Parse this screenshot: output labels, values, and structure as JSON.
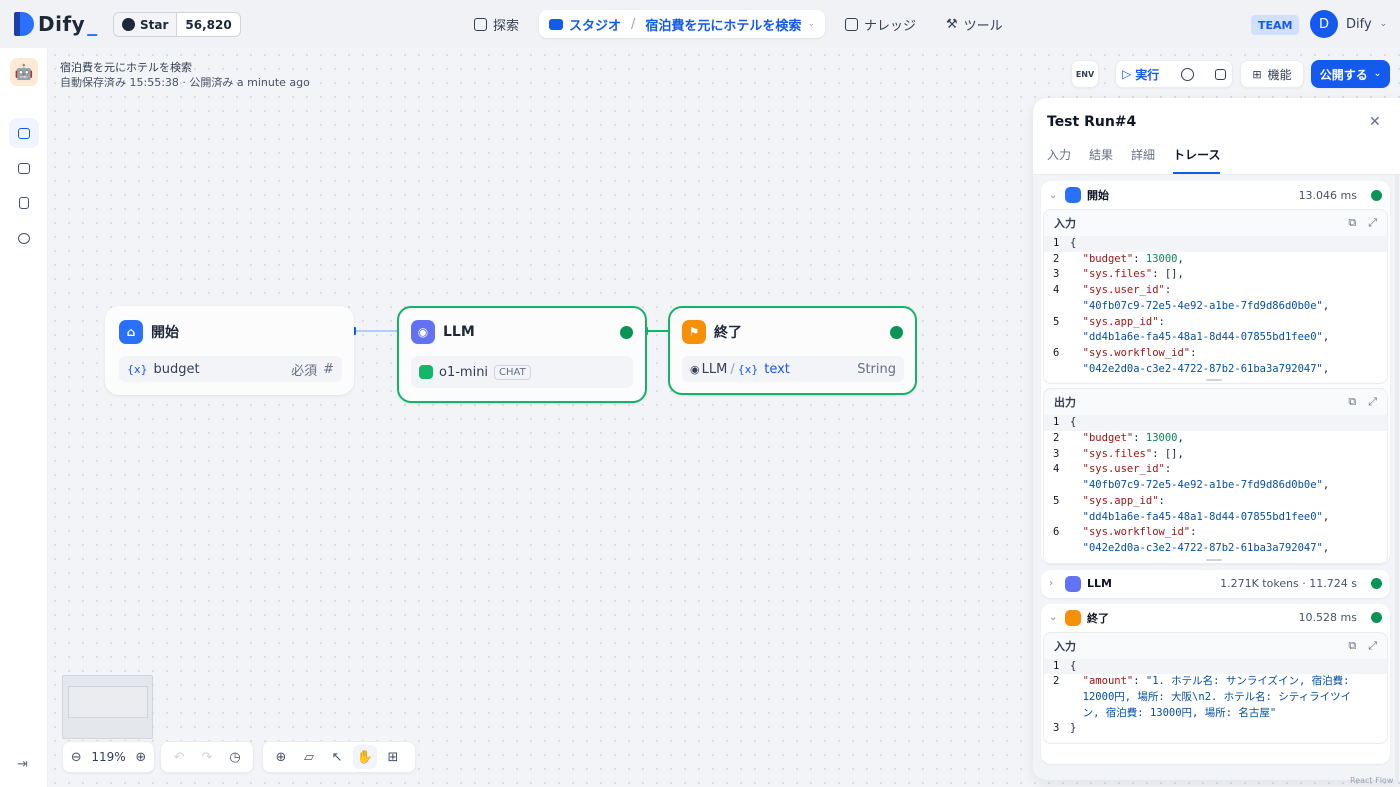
{
  "header": {
    "brand": "Dify",
    "github": {
      "star_label": "Star",
      "count": "56,820"
    },
    "nav": {
      "explore": "探索",
      "studio": "スタジオ",
      "app_name": "宿泊費を元にホテルを検索",
      "knowledge": "ナレッジ",
      "tools": "ツール"
    },
    "team_badge": "TEAM",
    "user": {
      "initial": "D",
      "name": "Dify"
    }
  },
  "app": {
    "title": "宿泊費を元にホテルを検索",
    "status": "自動保存済み 15:55:38 · 公開済み a minute ago"
  },
  "toolbar": {
    "env": "ENV",
    "run": "実行",
    "features": "機能",
    "publish": "公開する"
  },
  "nodes": {
    "start": {
      "title": "開始",
      "var_icon": "{x}",
      "var": "budget",
      "required": "必須",
      "type_icon": "#"
    },
    "llm": {
      "title": "LLM",
      "model": "o1-mini",
      "mode": "CHAT"
    },
    "end": {
      "title": "終了",
      "source": "LLM",
      "slash": "/",
      "var_icon": "{x}",
      "var": "text",
      "type": "String"
    }
  },
  "zoom": "119%",
  "panel": {
    "title": "Test Run#4",
    "tabs": [
      "入力",
      "結果",
      "詳細",
      "トレース"
    ],
    "active_tab": "トレース",
    "steps": {
      "start": {
        "title": "開始",
        "time": "13.046 ms",
        "input_label": "入力",
        "output_label": "出力",
        "json": [
          {
            "ln": "1",
            "t": "{"
          },
          {
            "ln": "2",
            "k": "\"budget\"",
            "v": "13000",
            "vt": "n",
            "tail": ","
          },
          {
            "ln": "3",
            "k": "\"sys.files\"",
            "v": "[]",
            "vt": "p",
            "tail": ","
          },
          {
            "ln": "4",
            "k": "\"sys.user_id\"",
            "v": "",
            "vt": "s",
            "tail": ""
          },
          {
            "ln": "",
            "k": "",
            "v": "\"40fb07c9-72e5-4e92-a1be-7fd9d86d0b0e\"",
            "vt": "s",
            "tail": ","
          },
          {
            "ln": "5",
            "k": "\"sys.app_id\"",
            "v": "",
            "vt": "s",
            "tail": ""
          },
          {
            "ln": "",
            "k": "",
            "v": "\"dd4b1a6e-fa45-48a1-8d44-07855bd1fee0\"",
            "vt": "s",
            "tail": ","
          },
          {
            "ln": "6",
            "k": "\"sys.workflow_id\"",
            "v": "",
            "vt": "s",
            "tail": ""
          },
          {
            "ln": "",
            "k": "",
            "v": "\"042e2d0a-c3e2-4722-87b2-61ba3a792047\"",
            "vt": "s",
            "tail": ","
          }
        ]
      },
      "llm": {
        "title": "LLM",
        "time": "1.271K tokens · 11.724 s"
      },
      "end": {
        "title": "終了",
        "time": "10.528 ms",
        "input_label": "入力",
        "json": [
          {
            "ln": "1",
            "t": "{"
          },
          {
            "ln": "2",
            "k": "\"amount\"",
            "v": "\"1. ホテル名: サンライズイン, 宿泊費:",
            "vt": "s",
            "tail": ""
          },
          {
            "ln": "",
            "k": "",
            "v": "12000円, 場所: 大阪\\n2. ホテル名: シティライツイ",
            "vt": "s",
            "tail": ""
          },
          {
            "ln": "",
            "k": "",
            "v": "ン, 宿泊費: 13000円, 場所: 名古屋\"",
            "vt": "s",
            "tail": ""
          },
          {
            "ln": "3",
            "t": "}"
          }
        ]
      }
    }
  },
  "footer": {
    "reactflow": "React Flow"
  },
  "colors": {
    "accent": "#155aef",
    "success": "#079455",
    "llm": "#6172f3",
    "end": "#f79009"
  }
}
